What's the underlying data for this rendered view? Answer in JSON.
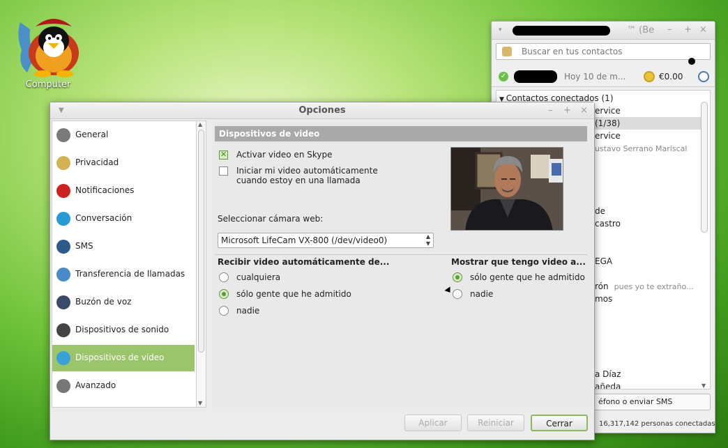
{
  "desktop": {
    "icon_label": "Computer"
  },
  "skype": {
    "title_suffix": "™ (Be",
    "search_placeholder": "Buscar en tus contactos",
    "mood": "Hoy 10 de m...",
    "credit": "€0.00",
    "group_label": "Contactos conectados (1)",
    "contacts": [
      {
        "text": "ervice"
      },
      {
        "text": "(1/38)"
      },
      {
        "text": "ervice"
      },
      {
        "text": "ustavo Serrano Mariscal",
        "muted": true
      },
      {
        "text": "de"
      },
      {
        "text": "castro"
      },
      {
        "text": "EGA"
      },
      {
        "text": "rón",
        "extra": "pues yo te extraño..."
      },
      {
        "text": "mos"
      },
      {
        "text": "a Díaz"
      },
      {
        "text": "añeda"
      }
    ],
    "bottom_button": "éfono o enviar SMS",
    "footer": "16,317,142 personas conectadas"
  },
  "dialog": {
    "title": "Opciones",
    "sidebar": [
      {
        "label": "General",
        "icon": "general-icon",
        "color": "#7a7a7a"
      },
      {
        "label": "Privacidad",
        "icon": "privacy-key-icon",
        "color": "#d4b254"
      },
      {
        "label": "Notificaciones",
        "icon": "flag-icon",
        "color": "#cc2222"
      },
      {
        "label": "Conversación",
        "icon": "chat-icon",
        "color": "#2a9ad6"
      },
      {
        "label": "SMS",
        "icon": "sms-icon",
        "color": "#2d5a8a"
      },
      {
        "label": "Transferencia de llamadas",
        "icon": "call-forward-icon",
        "color": "#4a8ac8"
      },
      {
        "label": "Buzón de voz",
        "icon": "voicemail-icon",
        "color": "#3a4a6a"
      },
      {
        "label": "Dispositivos de sonido",
        "icon": "headset-icon",
        "color": "#444444"
      },
      {
        "label": "Dispositivos de video",
        "icon": "video-camera-icon",
        "color": "#3aa0d8"
      },
      {
        "label": "Avanzado",
        "icon": "gear-icon",
        "color": "#777777"
      }
    ],
    "section_title": "Dispositivos de video",
    "enable_video": {
      "label": "Activar video en Skype",
      "checked": true
    },
    "auto_start": {
      "line1": "Iniciar mi video automáticamente",
      "line2": "cuando estoy en una llamada",
      "checked": false
    },
    "camera_label": "Seleccionar cámara web:",
    "camera_value": "Microsoft LifeCam VX-800 (/dev/video0)",
    "receive": {
      "title": "Recibir video automáticamente de...",
      "options": [
        "cualquiera",
        "sólo gente que he admitido",
        "nadie"
      ],
      "selected": 1
    },
    "show": {
      "title": "Mostrar que tengo video a...",
      "options": [
        "sólo gente que he admitido",
        "nadie"
      ],
      "selected": 0
    },
    "buttons": {
      "apply": "Aplicar",
      "reset": "Reiniciar",
      "close": "Cerrar"
    }
  }
}
